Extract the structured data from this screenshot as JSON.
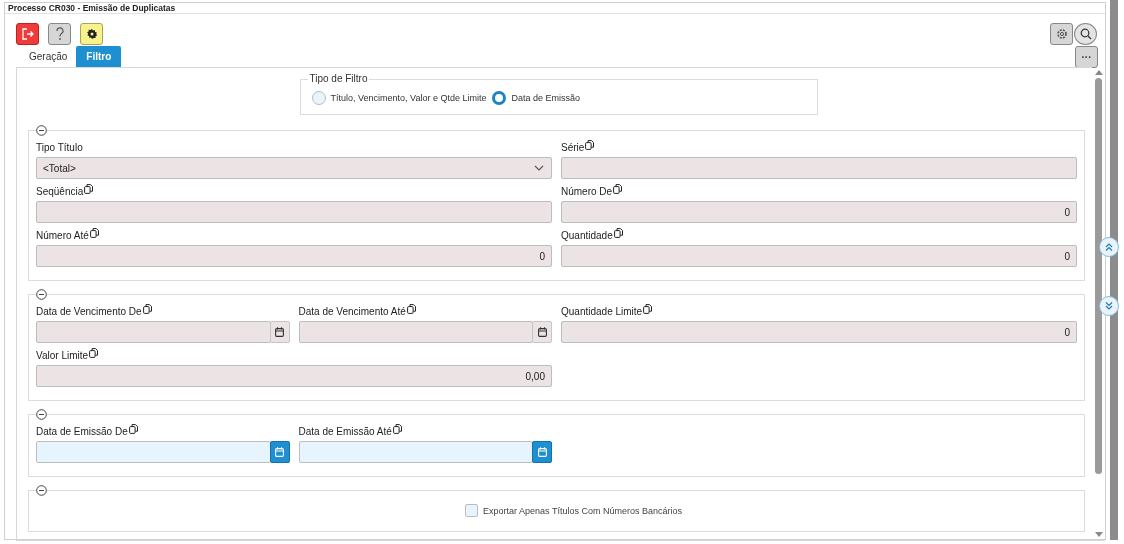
{
  "window": {
    "title": "Processo CR030 - Emissão de Duplicatas"
  },
  "tabs": [
    {
      "label": "Geração",
      "selected": false
    },
    {
      "label": "Filtro",
      "selected": true
    }
  ],
  "more_button": {
    "label": "···"
  },
  "filter_type": {
    "legend": "Tipo de Filtro",
    "options": [
      {
        "label": "Título, Vencimento, Valor e Qtde Limite",
        "selected": false
      },
      {
        "label": "Data de Emissão",
        "selected": true
      }
    ]
  },
  "sections": [
    {
      "kind": "fields",
      "fields": [
        {
          "label": "Tipo Título",
          "kind": "select",
          "value": "<Total>",
          "disabled": true
        },
        {
          "label": "Série",
          "kind": "text",
          "disabled": true
        },
        {
          "label": "Seqüência",
          "kind": "text",
          "disabled": true
        },
        {
          "label": "Número De",
          "kind": "number",
          "value": "0",
          "disabled": true
        },
        {
          "label": "Número Até",
          "kind": "number",
          "value": "0",
          "disabled": true
        },
        {
          "label": "Quantidade",
          "kind": "number",
          "value": "0",
          "disabled": true
        }
      ]
    },
    {
      "kind": "fields",
      "fields": [
        {
          "label": "Data de Vencimento De",
          "kind": "date",
          "disabled": true
        },
        {
          "label": "Data de Vencimento Até",
          "kind": "date",
          "disabled": true
        },
        {
          "label": "Quantidade Limite",
          "kind": "number",
          "value": "0",
          "disabled": true
        },
        {
          "label": "Valor Limite",
          "kind": "number",
          "value": "0,00",
          "disabled": true
        }
      ]
    },
    {
      "kind": "fields",
      "fields": [
        {
          "label": "Data de Emissão De",
          "kind": "date",
          "disabled": false
        },
        {
          "label": "Data de Emissão Até",
          "kind": "date",
          "disabled": false
        }
      ]
    },
    {
      "kind": "checkbox",
      "label": "Exportar Apenas Títulos Com Números Bancários",
      "checked": false
    }
  ]
}
